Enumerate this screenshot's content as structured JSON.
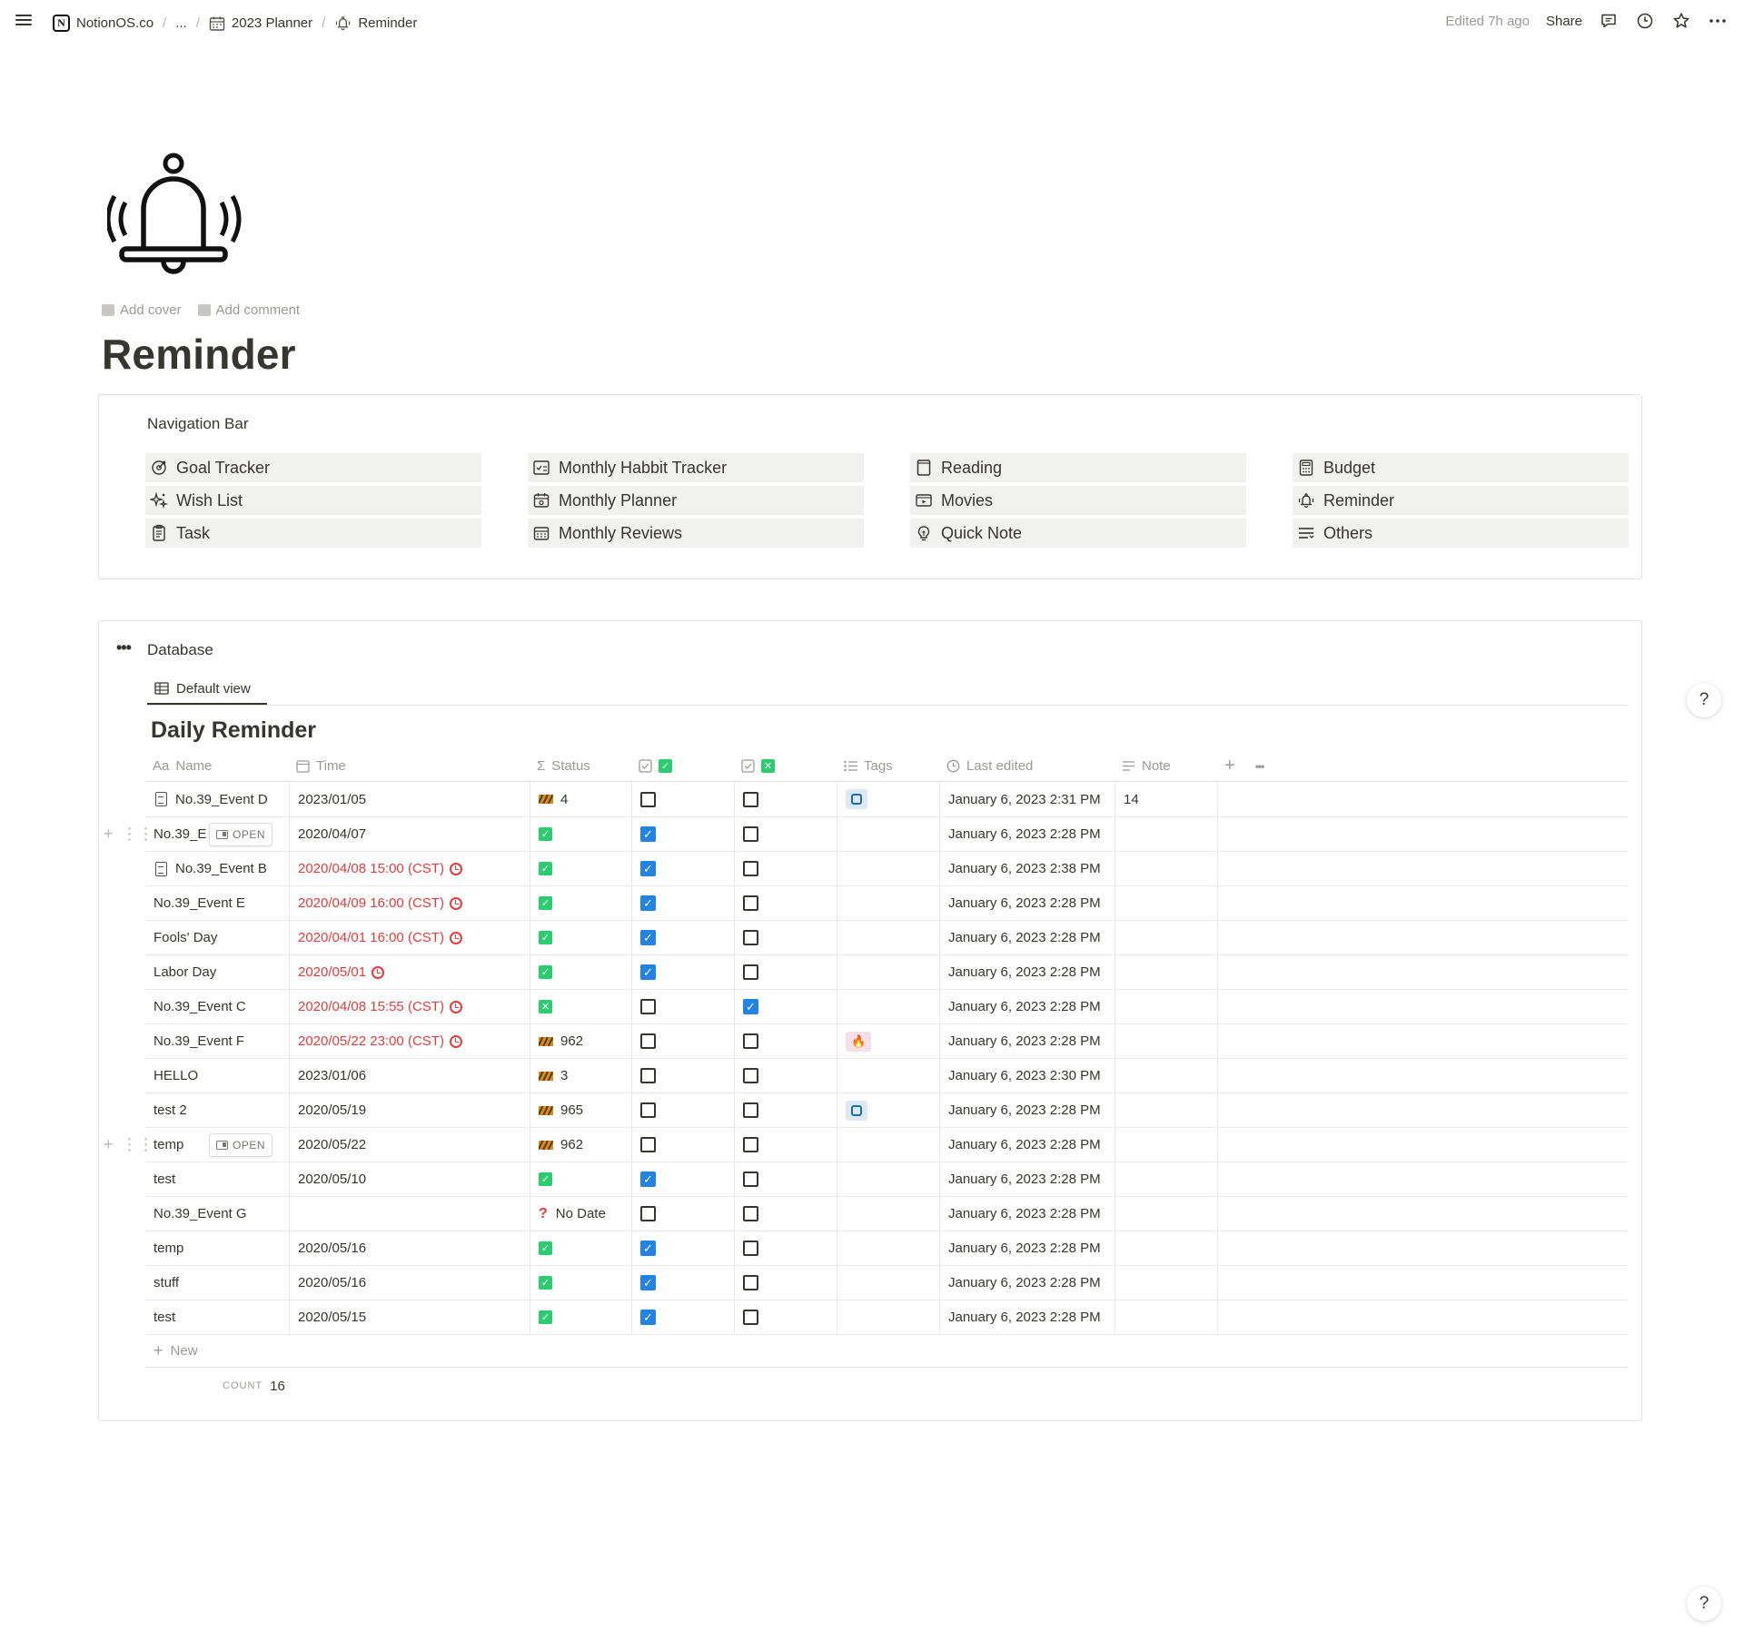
{
  "breadcrumb": [
    "NotionOS.co",
    "...",
    "2023 Planner",
    "Reminder"
  ],
  "topbar": {
    "edited": "Edited 7h ago",
    "share": "Share"
  },
  "page": {
    "add_cover": "Add cover",
    "add_comment": "Add comment",
    "title": "Reminder",
    "icon": "bell-ringing-icon"
  },
  "nav": {
    "heading": "Navigation Bar",
    "columns": [
      [
        {
          "label": "Goal Tracker",
          "icon": "goal-icon"
        },
        {
          "label": "Wish List",
          "icon": "sparkles-icon"
        },
        {
          "label": "Task",
          "icon": "clipboard-icon"
        }
      ],
      [
        {
          "label": "Monthly Habbit Tracker",
          "icon": "habit-icon"
        },
        {
          "label": "Monthly Planner",
          "icon": "calendar-icon"
        },
        {
          "label": "Monthly Reviews",
          "icon": "calendar-grid-icon"
        }
      ],
      [
        {
          "label": "Reading",
          "icon": "book-icon"
        },
        {
          "label": "Movies",
          "icon": "film-icon"
        },
        {
          "label": "Quick Note",
          "icon": "lightbulb-icon"
        }
      ],
      [
        {
          "label": "Budget",
          "icon": "calculator-icon"
        },
        {
          "label": "Reminder",
          "icon": "bell-icon"
        },
        {
          "label": "Others",
          "icon": "list-icon"
        }
      ]
    ]
  },
  "database": {
    "title": "Database",
    "view": "Default view",
    "table_title": "Daily Reminder",
    "columns": {
      "name": "Name",
      "name_prefix": "Aa",
      "time": "Time",
      "status": "Status",
      "tags": "Tags",
      "last_edited": "Last edited",
      "note": "Note"
    },
    "rows": [
      {
        "name": "No.39_Event D",
        "doc": true,
        "open": false,
        "time": "2023/01/05",
        "red": false,
        "alarm": false,
        "status": "stripe",
        "status_text": "4",
        "c1": false,
        "c2": false,
        "tag": "blue",
        "edited": "January 6, 2023 2:31 PM",
        "note": "14"
      },
      {
        "name": "No.39_Event A",
        "doc": false,
        "open": true,
        "time": "2020/04/07",
        "red": false,
        "alarm": false,
        "status": "ok",
        "status_text": "",
        "c1": true,
        "c2": false,
        "tag": "",
        "edited": "January 6, 2023 2:28 PM",
        "note": ""
      },
      {
        "name": "No.39_Event B",
        "doc": true,
        "open": false,
        "time": "2020/04/08 15:00 (CST)",
        "red": true,
        "alarm": true,
        "status": "ok",
        "status_text": "",
        "c1": true,
        "c2": false,
        "tag": "",
        "edited": "January 6, 2023 2:38 PM",
        "note": ""
      },
      {
        "name": "No.39_Event E",
        "doc": false,
        "open": false,
        "time": "2020/04/09 16:00 (CST)",
        "red": true,
        "alarm": true,
        "status": "ok",
        "status_text": "",
        "c1": true,
        "c2": false,
        "tag": "",
        "edited": "January 6, 2023 2:28 PM",
        "note": ""
      },
      {
        "name": "Fools' Day",
        "doc": false,
        "open": false,
        "time": "2020/04/01 16:00 (CST)",
        "red": true,
        "alarm": true,
        "status": "ok",
        "status_text": "",
        "c1": true,
        "c2": false,
        "tag": "",
        "edited": "January 6, 2023 2:28 PM",
        "note": ""
      },
      {
        "name": "Labor Day",
        "doc": false,
        "open": false,
        "time": "2020/05/01",
        "red": true,
        "alarm": true,
        "status": "ok",
        "status_text": "",
        "c1": true,
        "c2": false,
        "tag": "",
        "edited": "January 6, 2023 2:28 PM",
        "note": ""
      },
      {
        "name": "No.39_Event C",
        "doc": false,
        "open": false,
        "time": "2020/04/08 15:55 (CST)",
        "red": true,
        "alarm": true,
        "status": "x",
        "status_text": "",
        "c1": false,
        "c2": true,
        "tag": "",
        "edited": "January 6, 2023 2:28 PM",
        "note": ""
      },
      {
        "name": "No.39_Event F",
        "doc": false,
        "open": false,
        "time": "2020/05/22 23:00 (CST)",
        "red": true,
        "alarm": true,
        "status": "stripe",
        "status_text": "962",
        "c1": false,
        "c2": false,
        "tag": "pink",
        "edited": "January 6, 2023 2:28 PM",
        "note": ""
      },
      {
        "name": "HELLO",
        "doc": false,
        "open": false,
        "time": "2023/01/06",
        "red": false,
        "alarm": false,
        "status": "stripe",
        "status_text": "3",
        "c1": false,
        "c2": false,
        "tag": "",
        "edited": "January 6, 2023 2:30 PM",
        "note": ""
      },
      {
        "name": "test 2",
        "doc": false,
        "open": false,
        "time": "2020/05/19",
        "red": false,
        "alarm": false,
        "status": "stripe",
        "status_text": "965",
        "c1": false,
        "c2": false,
        "tag": "blue",
        "edited": "January 6, 2023 2:28 PM",
        "note": ""
      },
      {
        "name": "temp",
        "doc": false,
        "open": true,
        "time": "2020/05/22",
        "red": false,
        "alarm": false,
        "status": "stripe",
        "status_text": "962",
        "c1": false,
        "c2": false,
        "tag": "",
        "edited": "January 6, 2023 2:28 PM",
        "note": ""
      },
      {
        "name": "test",
        "doc": false,
        "open": false,
        "time": "2020/05/10",
        "red": false,
        "alarm": false,
        "status": "ok",
        "status_text": "",
        "c1": true,
        "c2": false,
        "tag": "",
        "edited": "January 6, 2023 2:28 PM",
        "note": ""
      },
      {
        "name": "No.39_Event G",
        "doc": false,
        "open": false,
        "time": "",
        "red": false,
        "alarm": false,
        "status": "q",
        "status_text": "No Date",
        "c1": false,
        "c2": false,
        "tag": "",
        "edited": "January 6, 2023 2:28 PM",
        "note": ""
      },
      {
        "name": "temp",
        "doc": false,
        "open": false,
        "time": "2020/05/16",
        "red": false,
        "alarm": false,
        "status": "ok",
        "status_text": "",
        "c1": true,
        "c2": false,
        "tag": "",
        "edited": "January 6, 2023 2:28 PM",
        "note": ""
      },
      {
        "name": "stuff",
        "doc": false,
        "open": false,
        "time": "2020/05/16",
        "red": false,
        "alarm": false,
        "status": "ok",
        "status_text": "",
        "c1": true,
        "c2": false,
        "tag": "",
        "edited": "January 6, 2023 2:28 PM",
        "note": ""
      },
      {
        "name": "test",
        "doc": false,
        "open": false,
        "time": "2020/05/15",
        "red": false,
        "alarm": false,
        "status": "ok",
        "status_text": "",
        "c1": true,
        "c2": false,
        "tag": "",
        "edited": "January 6, 2023 2:28 PM",
        "note": ""
      }
    ],
    "new_label": "New",
    "open_label": "OPEN",
    "count_label": "COUNT",
    "count_value": "16"
  },
  "help_label": "?",
  "colors": {
    "text": "#37352f",
    "muted": "#9b9a97",
    "accent_blue": "#2383e2",
    "red": "#e03e3e",
    "status_green": "#2ecc71",
    "nav_bg": "#f1f1ef"
  }
}
